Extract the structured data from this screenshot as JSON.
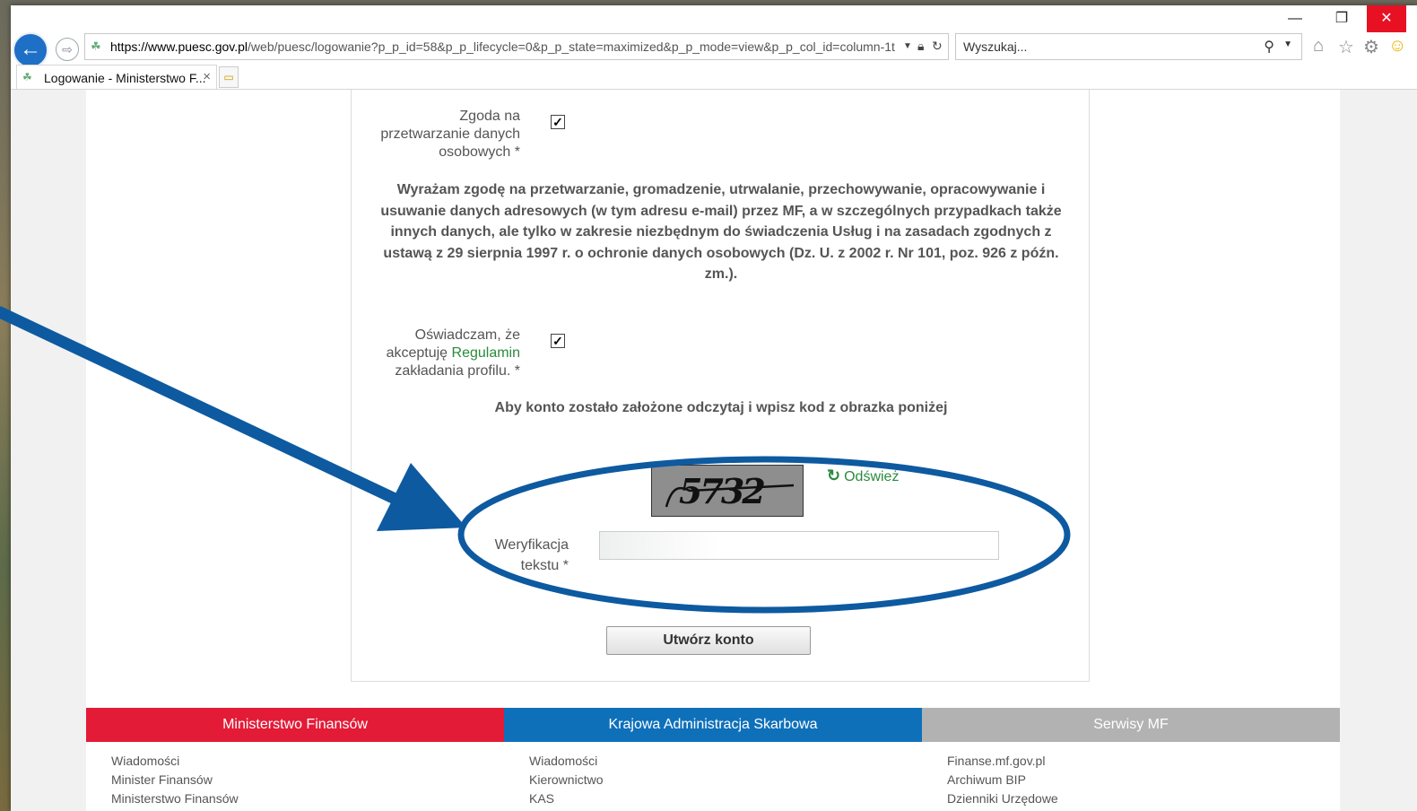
{
  "browser": {
    "url_host": "https://www.puesc.gov.pl",
    "url_path": "/web/puesc/logowanie?p_p_id=58&p_p_lifecycle=0&p_p_state=maximized&p_p_mode=view&p_p_col_id=column-1t",
    "search_placeholder": "Wyszukaj...",
    "tab_title": "Logowanie - Ministerstwo F...",
    "tab_close": "×"
  },
  "form": {
    "consent_label": "Zgoda na przetwarzanie danych osobowych *",
    "consent_text": "Wyrażam zgodę na przetwarzanie, gromadzenie, utrwalanie, przechowywanie, opracowywanie i usuwanie danych adresowych (w tym adresu e-mail) przez MF, a w szczególnych przypadkach także innych danych, ale tylko w zakresie niezbędnym do świadczenia Usług i na zasadach zgodnych z ustawą z 29 sierpnia 1997 r. o ochronie danych osobowych (Dz. U. z 2002 r. Nr 101, poz. 926 z późn. zm.).",
    "terms_label_before": "Oświadczam, że akceptuję",
    "terms_link": "Regulamin",
    "terms_label_after": "zakładania profilu. *",
    "checkbox_mark": "✓",
    "captcha_heading": "Aby konto zostało założone odczytaj i wpisz kod z obrazka poniżej",
    "captcha_code": "5732",
    "refresh_label": "Odśwież",
    "verify_label": "Weryfikacja tekstu *",
    "verify_value": "",
    "submit_label": "Utwórz konto"
  },
  "footer": {
    "columns": [
      {
        "title": "Ministerstwo Finansów",
        "color": "#e31b37",
        "links": [
          "Wiadomości",
          "Minister Finansów",
          "Ministerstwo Finansów"
        ]
      },
      {
        "title": "Krajowa Administracja Skarbowa",
        "color": "#0f70ba",
        "links": [
          "Wiadomości",
          "Kierownictwo",
          "KAS"
        ]
      },
      {
        "title": "Serwisy MF",
        "color": "#b2b2b2",
        "links": [
          "Finanse.mf.gov.pl",
          "Archiwum BIP",
          "Dzienniki Urzędowe"
        ]
      }
    ]
  },
  "colors": {
    "annotation": "#0d5aa0",
    "link_green": "#2b8a3e"
  }
}
